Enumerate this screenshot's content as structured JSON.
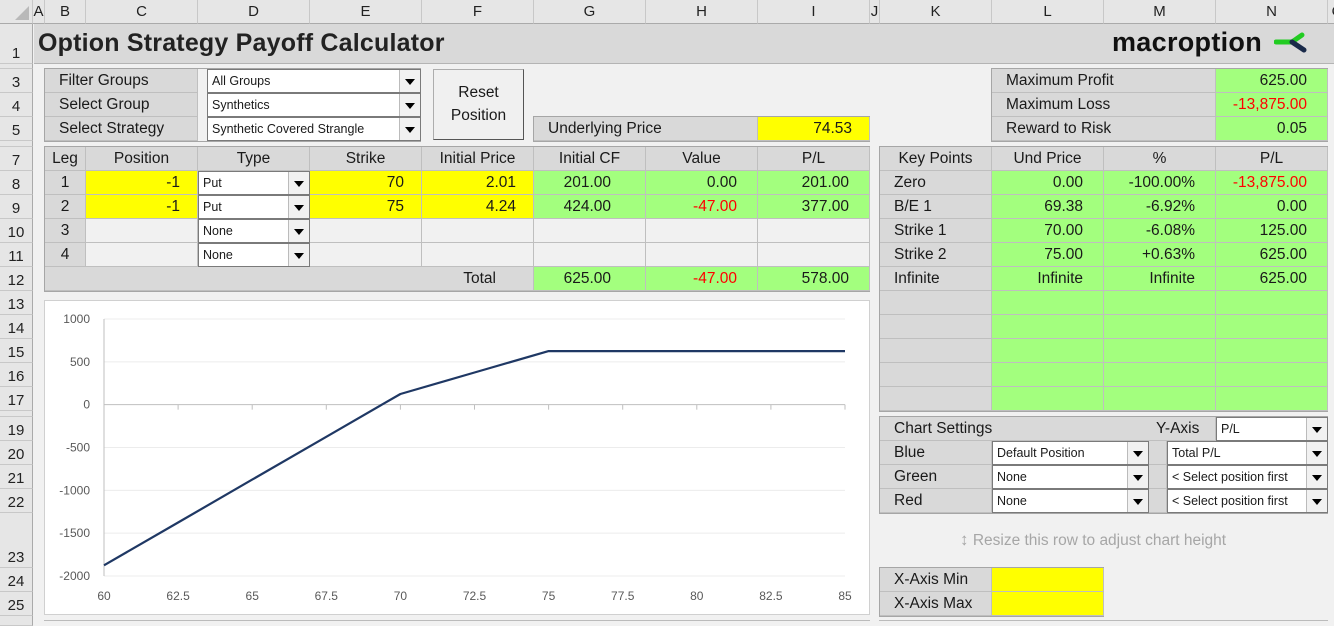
{
  "columns": [
    "A",
    "B",
    "C",
    "D",
    "E",
    "F",
    "G",
    "H",
    "I",
    "J",
    "K",
    "L",
    "M",
    "N",
    "O"
  ],
  "rows": [
    "1",
    "3",
    "4",
    "5",
    "7",
    "8",
    "9",
    "10",
    "11",
    "12",
    "13",
    "14",
    "15",
    "16",
    "17",
    "19",
    "20",
    "21",
    "22",
    "23",
    "24",
    "25"
  ],
  "title": "Option Strategy Payoff Calculator",
  "logo": {
    "text": "macroption",
    "icon": "macroption-logo-icon",
    "colors": {
      "green": "#22cc22",
      "navy": "#1a2a4a"
    }
  },
  "selectors": {
    "filter_groups": {
      "label": "Filter Groups",
      "value": "All Groups"
    },
    "select_group": {
      "label": "Select Group",
      "value": "Synthetics"
    },
    "select_strategy": {
      "label": "Select Strategy",
      "value": "Synthetic Covered Strangle"
    }
  },
  "reset_button": {
    "line1": "Reset",
    "line2": "Position"
  },
  "underlying": {
    "label": "Underlying Price",
    "value": "74.53"
  },
  "summary": {
    "max_profit": {
      "label": "Maximum Profit",
      "value": "625.00"
    },
    "max_loss": {
      "label": "Maximum Loss",
      "value": "-13,875.00"
    },
    "reward_risk": {
      "label": "Reward to Risk",
      "value": "0.05"
    }
  },
  "legs": {
    "headers": [
      "Leg",
      "Position",
      "Type",
      "Strike",
      "Initial Price",
      "Initial CF",
      "Value",
      "P/L"
    ],
    "rows": [
      {
        "leg": "1",
        "position": "-1",
        "type": "Put",
        "strike": "70",
        "initial_price": "2.01",
        "initial_cf": "201.00",
        "value": "0.00",
        "pl": "201.00"
      },
      {
        "leg": "2",
        "position": "-1",
        "type": "Put",
        "strike": "75",
        "initial_price": "4.24",
        "initial_cf": "424.00",
        "value": "-47.00",
        "pl": "377.00"
      },
      {
        "leg": "3",
        "position": "",
        "type": "None",
        "strike": "",
        "initial_price": "",
        "initial_cf": "",
        "value": "",
        "pl": ""
      },
      {
        "leg": "4",
        "position": "",
        "type": "None",
        "strike": "",
        "initial_price": "",
        "initial_cf": "",
        "value": "",
        "pl": ""
      }
    ],
    "total": {
      "label": "Total",
      "initial_cf": "625.00",
      "value": "-47.00",
      "pl": "578.00"
    }
  },
  "key_points": {
    "headers": [
      "Key Points",
      "Und Price",
      "%",
      "P/L"
    ],
    "rows": [
      {
        "name": "Zero",
        "und_price": "0.00",
        "pct": "-100.00%",
        "pl": "-13,875.00"
      },
      {
        "name": "B/E 1",
        "und_price": "69.38",
        "pct": "-6.92%",
        "pl": "0.00"
      },
      {
        "name": "Strike 1",
        "und_price": "70.00",
        "pct": "-6.08%",
        "pl": "125.00"
      },
      {
        "name": "Strike 2",
        "und_price": "75.00",
        "pct": "+0.63%",
        "pl": "625.00"
      },
      {
        "name": "Infinite",
        "und_price": "Infinite",
        "pct": "Infinite",
        "pl": "625.00"
      }
    ]
  },
  "chart_settings": {
    "title": "Chart Settings",
    "y_axis_label": "Y-Axis",
    "y_axis_value": "P/L",
    "rows": [
      {
        "label": "Blue",
        "position": "Default Position",
        "series": "Total P/L"
      },
      {
        "label": "Green",
        "position": "None",
        "series": "< Select position first"
      },
      {
        "label": "Red",
        "position": "None",
        "series": "< Select position first"
      }
    ]
  },
  "resize_hint": "Resize this row to adjust chart height",
  "x_axis": {
    "min_label": "X-Axis Min",
    "min_value": "",
    "max_label": "X-Axis Max",
    "max_value": ""
  },
  "colors": {
    "input_yellow": "#ffff00",
    "output_green": "#a3ff7e",
    "negative_red": "#ff0000",
    "line_navy": "#1f3864"
  },
  "chart_data": {
    "type": "line",
    "title": "",
    "xlabel": "",
    "ylabel": "",
    "xlim": [
      60,
      85
    ],
    "ylim": [
      -2000,
      1000
    ],
    "x_ticks": [
      "60",
      "62.5",
      "65",
      "67.5",
      "70",
      "72.5",
      "75",
      "77.5",
      "80",
      "82.5",
      "85"
    ],
    "y_ticks": [
      "1000",
      "500",
      "0",
      "-500",
      "-1000",
      "-1500",
      "-2000"
    ],
    "grid": "horizontal",
    "legend": "none",
    "series": [
      {
        "name": "Total P/L",
        "color": "#1f3864",
        "x": [
          60,
          62.5,
          65,
          67.5,
          69.38,
          70,
          72.5,
          75,
          77.5,
          80,
          82.5,
          85
        ],
        "y": [
          -1875,
          -1375,
          -875,
          -375,
          1,
          125,
          375,
          625,
          625,
          625,
          625,
          625
        ]
      }
    ]
  }
}
